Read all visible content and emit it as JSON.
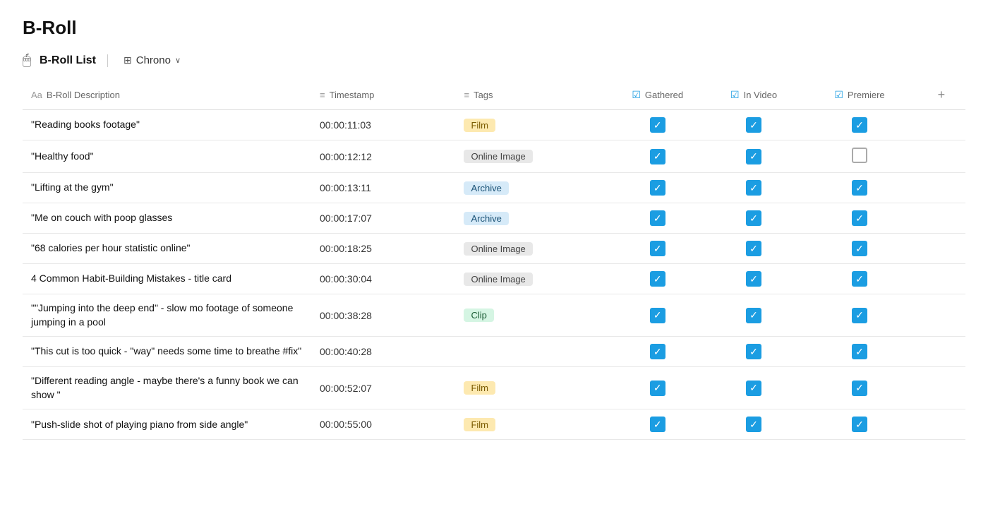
{
  "page": {
    "title": "B-Roll",
    "toolbar": {
      "icon": "🖱",
      "list_label": "B-Roll List",
      "view_icon": "⊞",
      "view_label": "Chrono",
      "chevron": "∨"
    },
    "columns": [
      {
        "id": "desc",
        "icon": "Aa",
        "label": "B-Roll Description"
      },
      {
        "id": "time",
        "icon": "≡",
        "label": "Timestamp"
      },
      {
        "id": "tags",
        "icon": "≡",
        "label": "Tags"
      },
      {
        "id": "gathered",
        "icon": "☑",
        "label": "Gathered"
      },
      {
        "id": "invideo",
        "icon": "☑",
        "label": "In Video"
      },
      {
        "id": "premiere",
        "icon": "☑",
        "label": "Premiere"
      }
    ],
    "rows": [
      {
        "desc": "\"Reading books footage\"",
        "timestamp": "00:00:11:03",
        "tag": "Film",
        "tag_type": "film",
        "gathered": true,
        "in_video": true,
        "premiere": true
      },
      {
        "desc": "\"Healthy food\"",
        "timestamp": "00:00:12:12",
        "tag": "Online Image",
        "tag_type": "online-image",
        "gathered": true,
        "in_video": true,
        "premiere": false
      },
      {
        "desc": "\"Lifting at the gym\"",
        "timestamp": "00:00:13:11",
        "tag": "Archive",
        "tag_type": "archive",
        "gathered": true,
        "in_video": true,
        "premiere": true
      },
      {
        "desc": "\"Me on couch with poop glasses",
        "timestamp": "00:00:17:07",
        "tag": "Archive",
        "tag_type": "archive",
        "gathered": true,
        "in_video": true,
        "premiere": true
      },
      {
        "desc": "\"68 calories per hour statistic online\"",
        "timestamp": "00:00:18:25",
        "tag": "Online Image",
        "tag_type": "online-image",
        "gathered": true,
        "in_video": true,
        "premiere": true
      },
      {
        "desc": "4 Common Habit-Building Mistakes - title card",
        "timestamp": "00:00:30:04",
        "tag": "Online Image",
        "tag_type": "online-image",
        "gathered": true,
        "in_video": true,
        "premiere": true
      },
      {
        "desc": "\"\"Jumping into the deep end\" - slow mo footage of someone jumping in a pool",
        "timestamp": "00:00:38:28",
        "tag": "Clip",
        "tag_type": "clip",
        "gathered": true,
        "in_video": true,
        "premiere": true
      },
      {
        "desc": "\"This cut is too quick - \"way\" needs some time to breathe #fix\"",
        "timestamp": "00:00:40:28",
        "tag": "",
        "tag_type": "",
        "gathered": true,
        "in_video": true,
        "premiere": true
      },
      {
        "desc": "\"Different reading angle - maybe there's a funny book we can show \"",
        "timestamp": "00:00:52:07",
        "tag": "Film",
        "tag_type": "film",
        "gathered": true,
        "in_video": true,
        "premiere": true
      },
      {
        "desc": "\"Push-slide shot of playing piano from side angle\"",
        "timestamp": "00:00:55:00",
        "tag": "Film",
        "tag_type": "film",
        "gathered": true,
        "in_video": true,
        "premiere": true
      }
    ],
    "add_column_label": "+"
  }
}
